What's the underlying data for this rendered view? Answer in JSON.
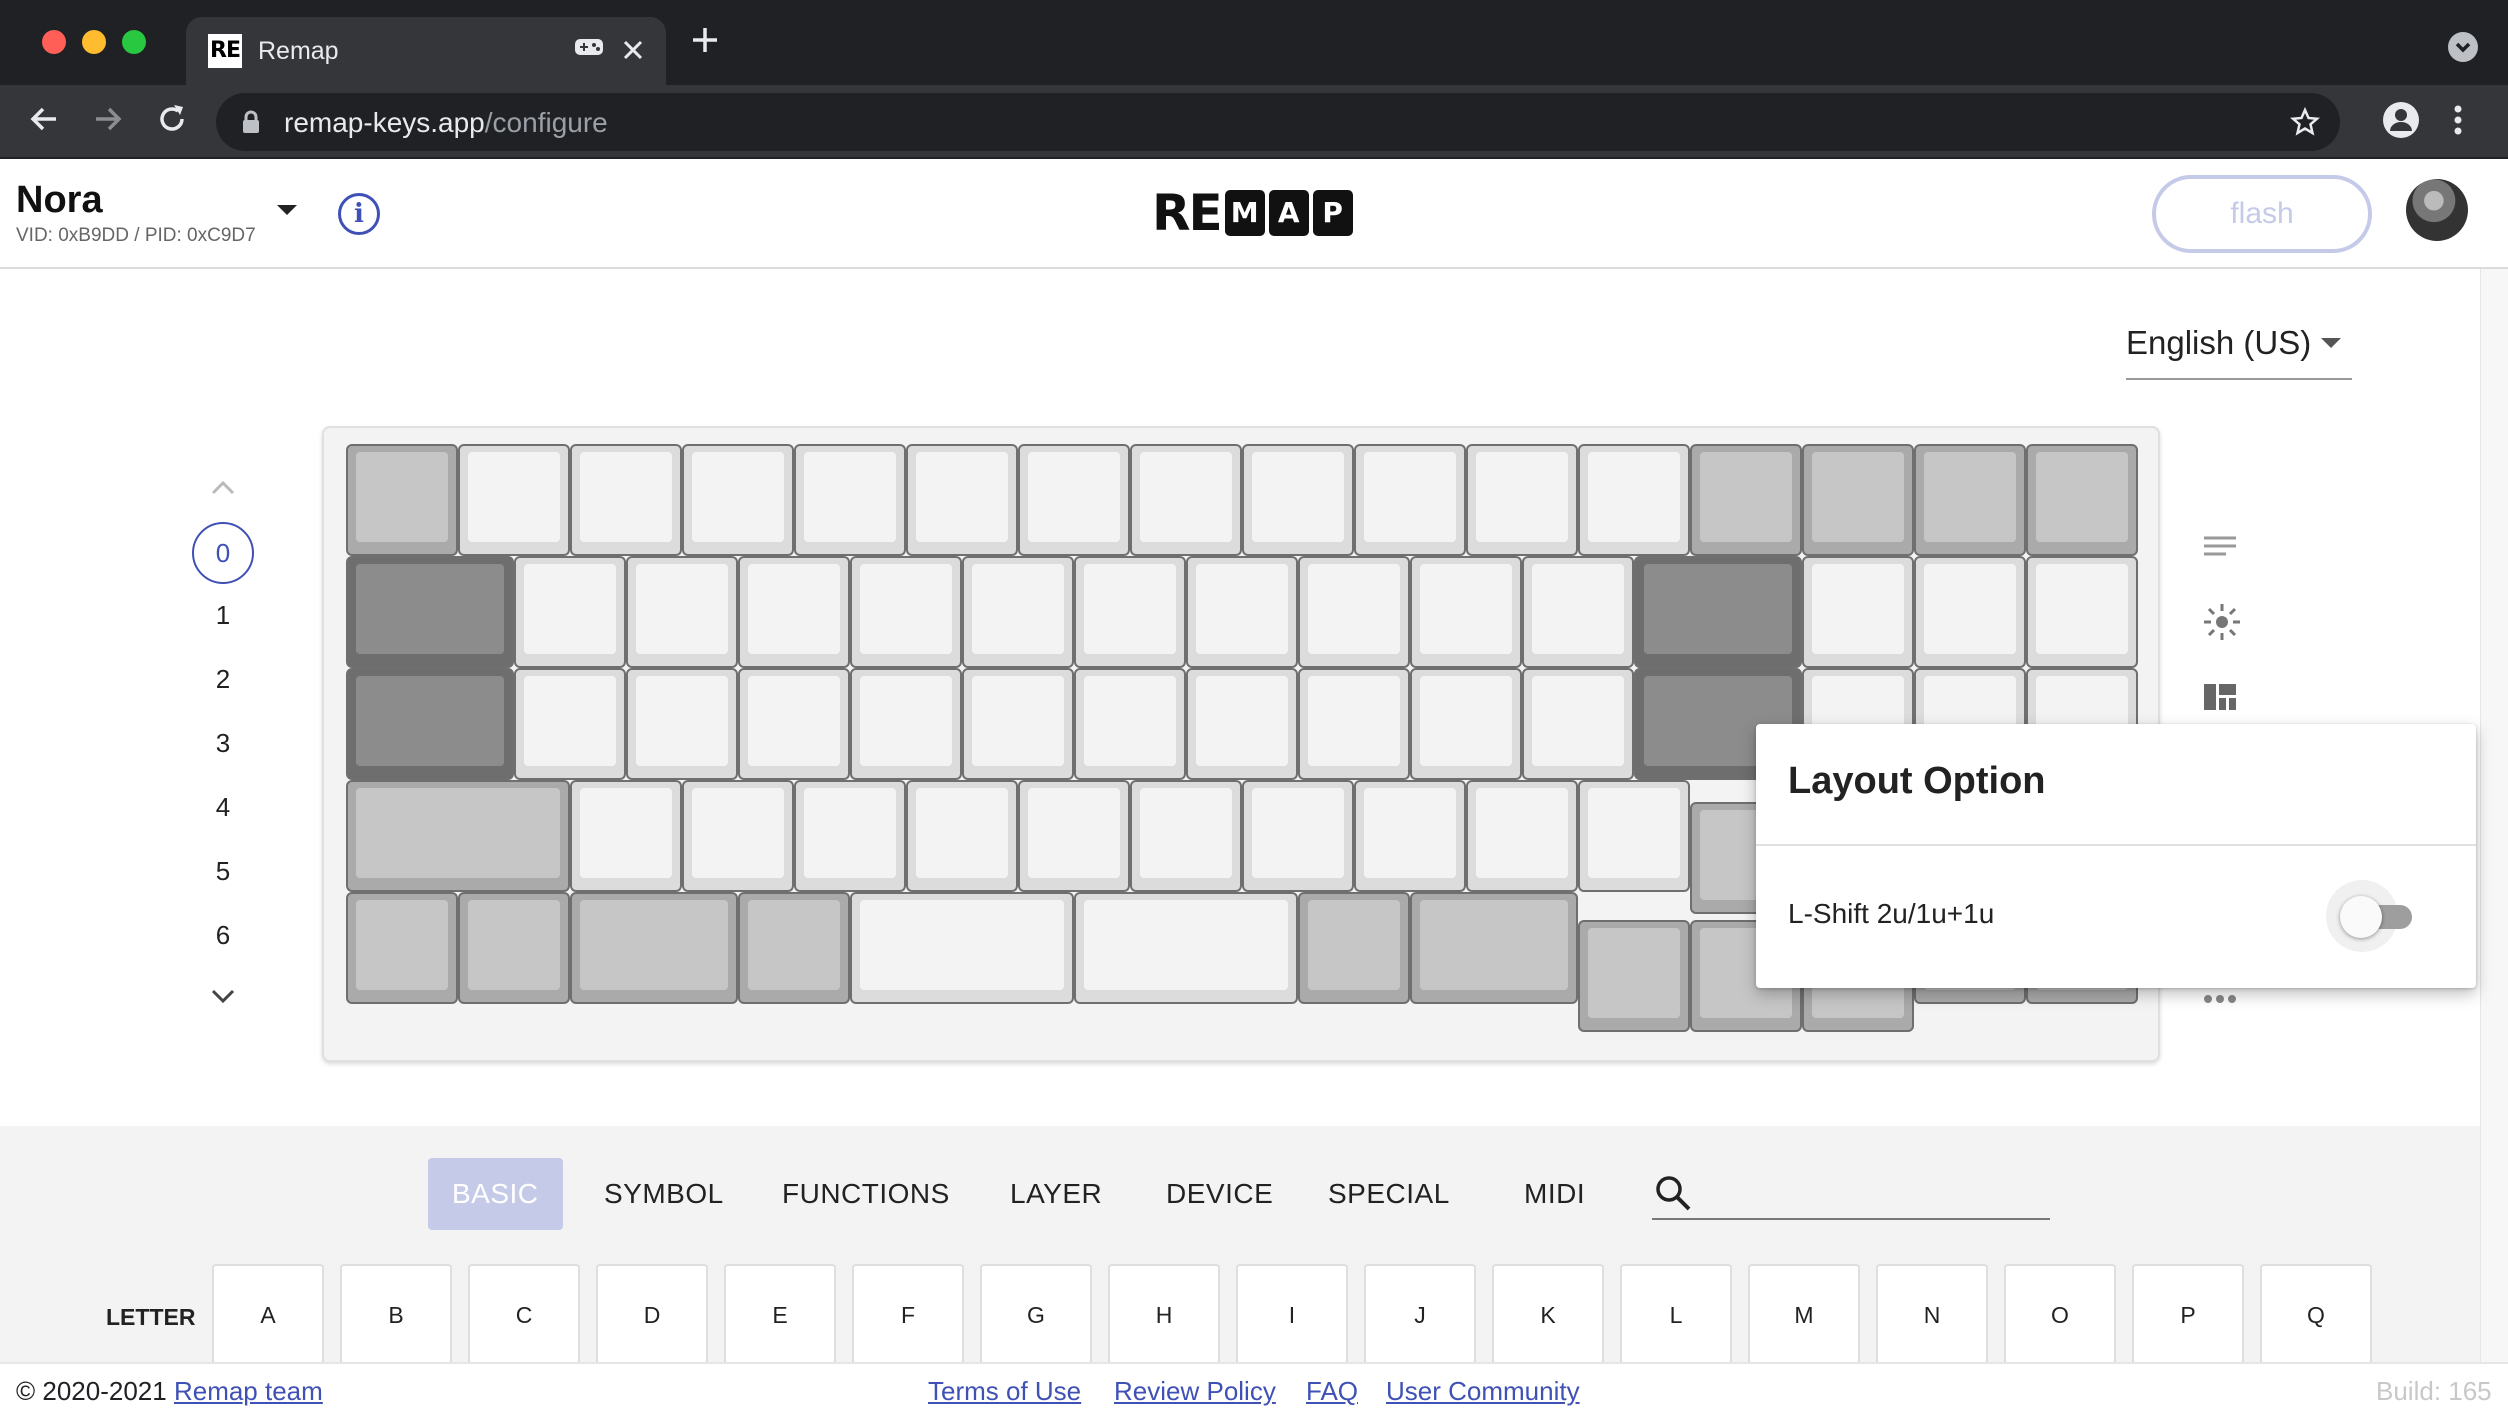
{
  "browser": {
    "tab_title": "Remap",
    "favicon_text": "RE",
    "url_host": "remap-keys.app",
    "url_path": "/configure"
  },
  "header": {
    "keyboard_name": "Nora",
    "ids": "VID: 0xB9DD / PID: 0xC9D7",
    "info_icon": "i",
    "logo_re": "RE",
    "logo_letters": [
      "M",
      "A",
      "P"
    ],
    "flash_label": "flash"
  },
  "language": {
    "selected": "English (US)"
  },
  "layers": {
    "items": [
      "0",
      "1",
      "2",
      "3",
      "4",
      "5",
      "6"
    ],
    "active": "0"
  },
  "layout_option": {
    "title": "Layout Option",
    "option_label": "L-Shift 2u/1u+1u",
    "enabled": false
  },
  "categories": {
    "tabs": [
      "BASIC",
      "SYMBOL",
      "FUNCTIONS",
      "LAYER",
      "DEVICE",
      "SPECIAL",
      "MIDI"
    ],
    "active": "BASIC",
    "search_value": ""
  },
  "letter_row": {
    "label": "LETTER",
    "keys": [
      "A",
      "B",
      "C",
      "D",
      "E",
      "F",
      "G",
      "H",
      "I",
      "J",
      "K",
      "L",
      "M",
      "N",
      "O",
      "P",
      "Q"
    ]
  },
  "footer": {
    "copyright": "© 2020-2021",
    "team_link": "Remap team",
    "terms": "Terms of Use",
    "review": "Review Policy",
    "faq": "FAQ",
    "community": "User Community",
    "build": "Build: 165"
  },
  "colors": {
    "accent": "#3f51b5",
    "accent_light": "#c5cae9",
    "chrome_dark": "#202124",
    "chrome_toolbar": "#35363a"
  }
}
